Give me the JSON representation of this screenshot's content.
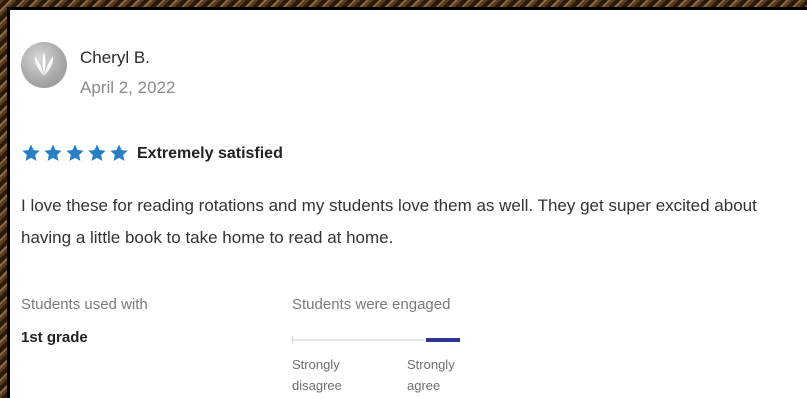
{
  "review": {
    "reviewer_name": "Cheryl B.",
    "date": "April 2, 2022",
    "rating": 5,
    "rating_label": "Extremely satisfied",
    "body": "I love these for reading rotations and my students love them as well. They get super excited about having a little book to take home to read at home.",
    "star_color": "#2a7fc4",
    "star_icon": "star-icon"
  },
  "details": {
    "students_used_with_label": "Students used with",
    "grade": "1st grade",
    "engagement_label": "Students were engaged",
    "engagement_level": 0.8,
    "engagement_color": "#2f3590",
    "scale_min_label_line1": "Strongly",
    "scale_min_label_line2": "disagree",
    "scale_max_label_line1": "Strongly",
    "scale_max_label_line2": "agree"
  }
}
